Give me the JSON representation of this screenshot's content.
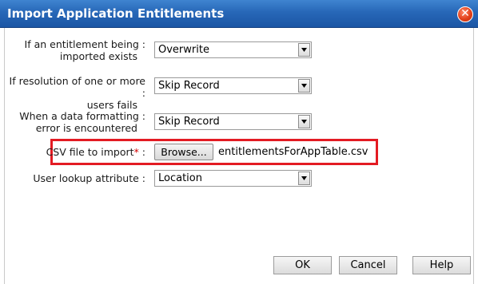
{
  "dialog": {
    "title": "Import Application Entitlements",
    "close_symbol": "✕"
  },
  "form": {
    "existing_label_line1": "If an entitlement being :",
    "existing_label_line2": "imported exists",
    "existing_value": "Overwrite",
    "resolution_label_line1": "If resolution of one or more :",
    "resolution_label_line2": "users fails",
    "resolution_value": "Skip Record",
    "formatting_label_line1": "When a data formatting :",
    "formatting_label_line2": "error is encountered",
    "formatting_value": "Skip Record",
    "csv_label": "CSV file to import",
    "csv_required": "*",
    "csv_colon": " :",
    "browse_label": "Browse...",
    "csv_filename": "entitlementsForAppTable.csv",
    "lookup_label": "User lookup attribute :",
    "lookup_value": "Location"
  },
  "buttons": {
    "ok": "OK",
    "cancel": "Cancel",
    "help": "Help"
  },
  "colors": {
    "titlebar": "#2767b7",
    "highlight_border": "#e31b23",
    "close_button": "#e2401a"
  }
}
